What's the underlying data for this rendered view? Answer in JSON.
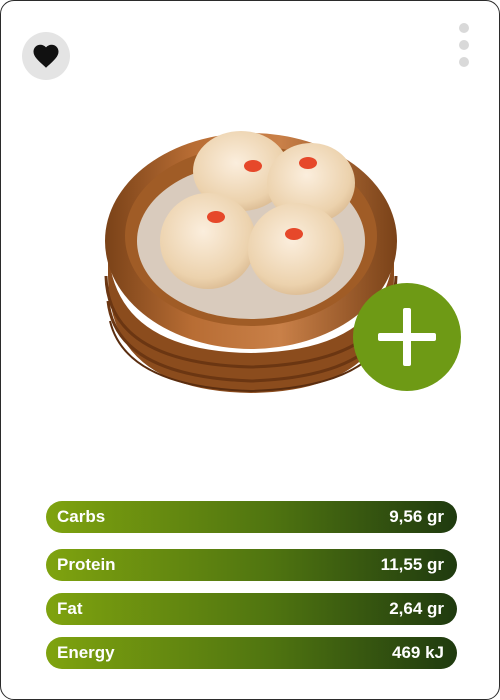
{
  "header": {
    "favorite_icon": "heart-icon",
    "more_icon": "vertical-dots-icon"
  },
  "food": {
    "title": "",
    "subtitle": "",
    "image_subject": "shumai dumplings in bamboo steamer",
    "add_icon": "plus-icon"
  },
  "nutrition": [
    {
      "label": "Carbs",
      "value": "9,56 gr"
    },
    {
      "label": "Protein",
      "value": "11,55 gr"
    },
    {
      "label": "Fat",
      "value": "2,64 gr"
    },
    {
      "label": "Energy",
      "value": "469 kJ"
    }
  ],
  "colors": {
    "accent": "#6e9a15",
    "bar_start": "#7fa30f",
    "bar_end": "#1f3a0f"
  }
}
